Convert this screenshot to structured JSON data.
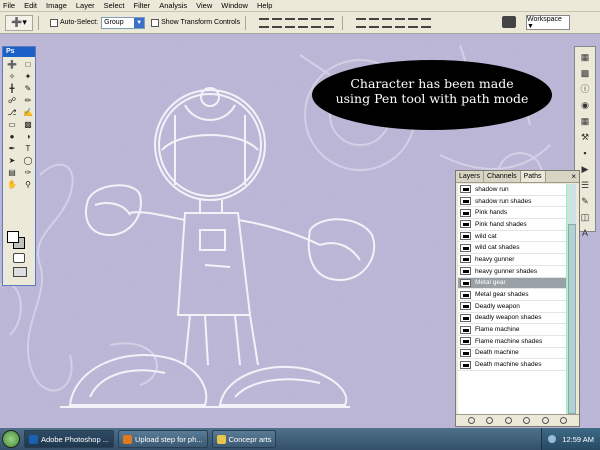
{
  "menu": [
    "File",
    "Edit",
    "Image",
    "Layer",
    "Select",
    "Filter",
    "Analysis",
    "View",
    "Window",
    "Help"
  ],
  "options_bar": {
    "auto_select_label": "Auto-Select:",
    "auto_select_value": "Group",
    "show_transform_label": "Show Transform Controls",
    "workspace_label": "Workspace ▼"
  },
  "toolbox": {
    "logo": "Ps"
  },
  "bubble": {
    "line1": "Character has been made",
    "line2": "using Pen tool with path mode"
  },
  "panel": {
    "tabs": [
      "Layers",
      "Channels",
      "Paths"
    ],
    "active_tab": "Paths",
    "close": "×",
    "paths": [
      "shadow run",
      "shadow run shades",
      "Pink hands",
      "Pink hand shades",
      "wild cat",
      "wild cat shades",
      "heavy gunner",
      "heavy gunner shades",
      "Metal gear",
      "Metal gear shades",
      "Deadly weapon",
      "deadly weapon shades",
      "Flame machine",
      "Flame machine shades",
      "Death machine",
      "Death machine shades"
    ],
    "selected_path": "Metal gear"
  },
  "taskbar": {
    "tasks": [
      {
        "label": "Adobe Photoshop ...",
        "icon_color": "#1b5fb0"
      },
      {
        "label": "Upload step for ph...",
        "icon_color": "#e07a1f"
      },
      {
        "label": "Concepr arts",
        "icon_color": "#e9c54a"
      }
    ],
    "clock": "12:59 AM"
  },
  "colors": {
    "canvas": "#b9b4d4",
    "ps_blue": "#1c60c8",
    "taskbar": "#3e6a86",
    "selected_row": "#9aa1a6"
  }
}
